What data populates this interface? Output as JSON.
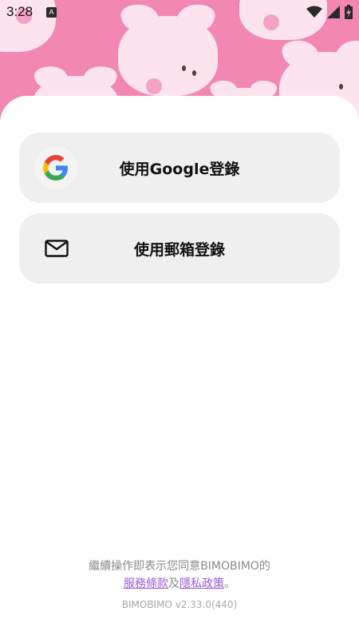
{
  "status_bar": {
    "time": "3:28",
    "notification_icon": "a-badge-icon",
    "icons": [
      "wifi-icon",
      "signal-icon",
      "battery-charging-icon"
    ]
  },
  "login": {
    "google_label": "使用Google登錄",
    "email_label": "使用郵箱登錄"
  },
  "footer": {
    "agreement_text": "繼續操作即表示您同意BIMOBIMO的",
    "terms_link": "服務條款",
    "conjunction": "及",
    "privacy_link": "隱私政策",
    "period": "。",
    "version": "BIMOBIMO v2.33.0(440)"
  },
  "colors": {
    "hero_pink": "#f287b1",
    "link_purple": "#9b59d9",
    "button_bg": "#efefef"
  }
}
